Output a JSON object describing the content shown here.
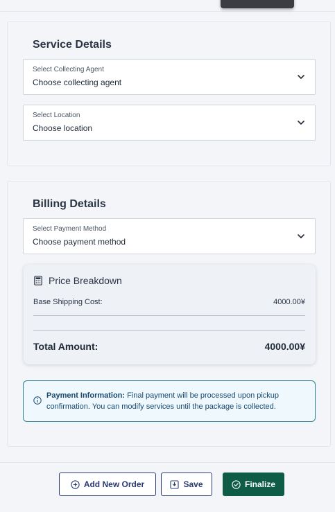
{
  "service": {
    "title": "Service Details",
    "agent": {
      "label": "Select Collecting Agent",
      "value": "Choose collecting agent"
    },
    "location": {
      "label": "Select Location",
      "value": "Choose location"
    }
  },
  "billing": {
    "title": "Billing Details",
    "payment": {
      "label": "Select Payment Method",
      "value": "Choose payment method"
    },
    "breakdown": {
      "title": "Price Breakdown",
      "base_label": "Base Shipping Cost:",
      "base_value": "4000.00¥",
      "total_label": "Total Amount:",
      "total_value": "4000.00¥"
    },
    "info": {
      "bold": "Payment Information:",
      "text": " Final payment will be processed upon pickup confirmation. You can modify services until the package is collected."
    }
  },
  "actions": {
    "add_label": "Add New Order",
    "save_label": "Save",
    "finalize_label": "Finalize"
  },
  "colors": {
    "primary_navy": "#2b3a73",
    "finalize_green": "#0f5c46",
    "info_border": "#2e7f8f",
    "info_bg": "#eff8fd"
  },
  "icons": [
    "chevron-down-icon",
    "calculator-icon",
    "info-icon",
    "plus-circle-icon",
    "save-icon",
    "check-circle-icon"
  ]
}
